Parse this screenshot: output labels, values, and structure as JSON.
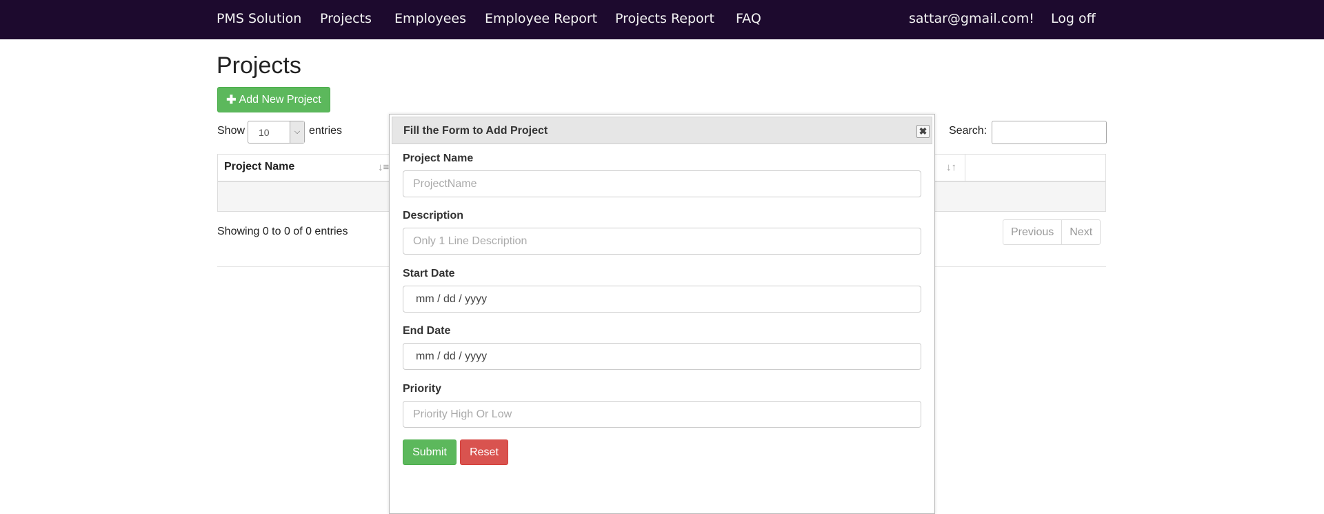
{
  "navbar": {
    "brand": "PMS Solution",
    "links": [
      "Projects",
      "Employees",
      "Employee Report",
      "Projects Report",
      "FAQ"
    ],
    "user": "sattar@gmail.com!",
    "logoff": "Log off"
  },
  "page": {
    "title": "Projects",
    "add_button": "Add New Project",
    "add_icon": "plus-icon"
  },
  "table": {
    "show_label": "Show",
    "length_value": "10",
    "entries_label": "entries",
    "search_label": "Search:",
    "search_value": "",
    "columns": [
      "Project Name"
    ],
    "info": "Showing 0 to 0 of 0 entries",
    "pagination": [
      "Previous",
      "Next"
    ]
  },
  "modal": {
    "title": "Fill the Form to Add Project",
    "close_icon": "close-icon",
    "fields": {
      "project_name": {
        "label": "Project Name",
        "placeholder": "ProjectName"
      },
      "description": {
        "label": "Description",
        "placeholder": "Only 1 Line Description"
      },
      "start_date": {
        "label": "Start Date",
        "placeholder": "mm / dd / yyyy"
      },
      "end_date": {
        "label": "End Date",
        "placeholder": "mm / dd / yyyy"
      },
      "priority": {
        "label": "Priority",
        "placeholder": "Priority High Or Low"
      }
    },
    "submit": "Submit",
    "reset": "Reset"
  },
  "colors": {
    "navbar": "#1d0a2e",
    "success": "#5cb85c",
    "danger": "#d9534f"
  }
}
